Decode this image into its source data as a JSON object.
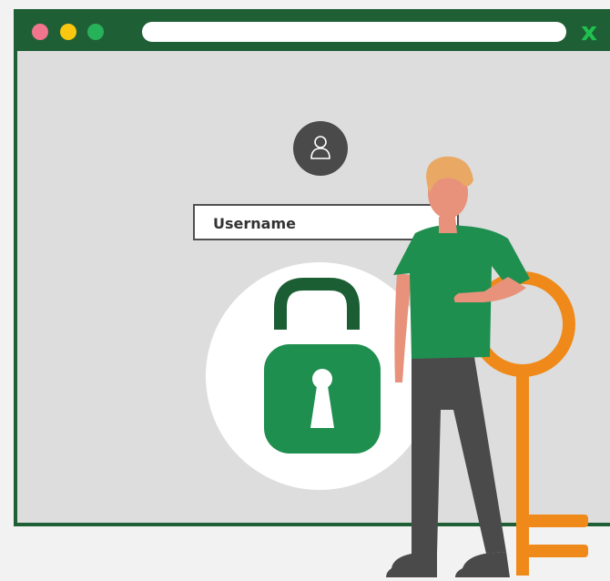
{
  "window": {
    "dots": [
      "#f0758d",
      "#f9c70f",
      "#27b259"
    ],
    "frame_color": "#1f5f36",
    "content_bg": "#dddddd"
  },
  "titlebar": {
    "close_glyph": "x",
    "close_color": "#1fc04d"
  },
  "login": {
    "avatar_icon": "user-icon",
    "username_value": "Username"
  },
  "lock": {
    "icon": "unlocked-padlock-icon",
    "body_color": "#1f8f4f",
    "shackle_color": "#1b5e33"
  },
  "illustration": {
    "person": "person-illustration",
    "key": "key-illustration",
    "key_color": "#ef8a1a",
    "shirt_color": "#1f8f4f",
    "pants_color": "#4a4a4a",
    "skin_color": "#e8927c",
    "hair_color": "#eaa865"
  }
}
